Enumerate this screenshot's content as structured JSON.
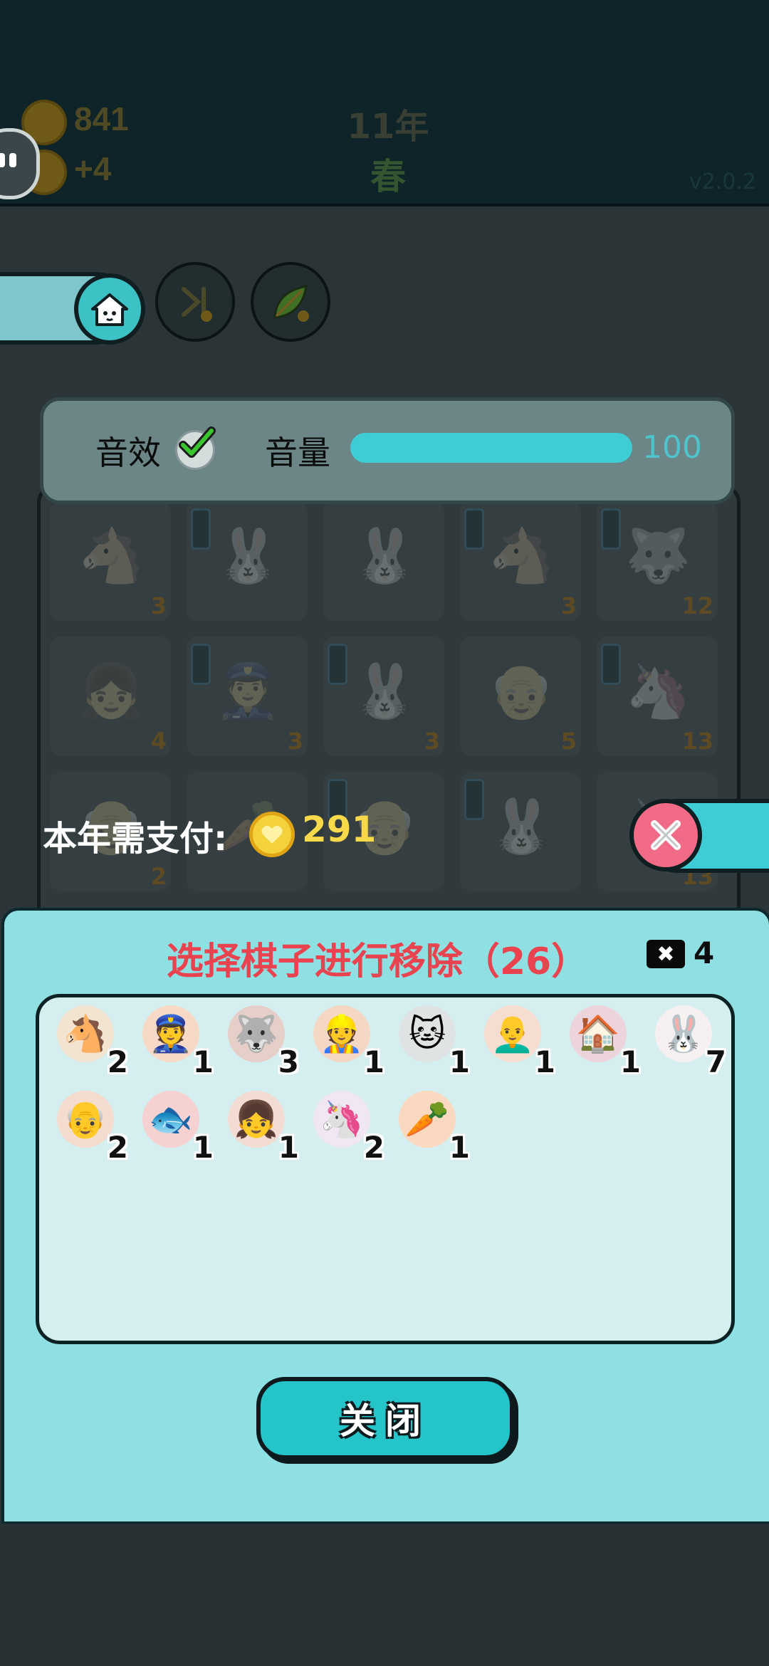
{
  "header": {
    "coins": "841",
    "income": "+4",
    "year": "11年",
    "season": "春",
    "version": "v2.0.2"
  },
  "settings": {
    "sound_label": "音效",
    "sound_enabled": true,
    "volume_label": "音量",
    "volume_value": "100",
    "volume_fraction": 1.0
  },
  "board": {
    "cells": [
      {
        "icon": "horse-icon",
        "glyph": "🐴",
        "count": "3"
      },
      {
        "icon": "rabbit-icon",
        "glyph": "🐰",
        "count": ""
      },
      {
        "icon": "rabbit-icon",
        "glyph": "🐰",
        "count": ""
      },
      {
        "icon": "horse-icon",
        "glyph": "🐴",
        "count": "3"
      },
      {
        "icon": "husky-icon",
        "glyph": "🐺",
        "count": "12"
      },
      {
        "icon": "girl-icon",
        "glyph": "👧",
        "count": "4"
      },
      {
        "icon": "police-icon",
        "glyph": "👮",
        "count": "3"
      },
      {
        "icon": "rabbit-icon",
        "glyph": "🐰",
        "count": "3"
      },
      {
        "icon": "old-man-icon",
        "glyph": "👴",
        "count": "5"
      },
      {
        "icon": "unicorn-icon",
        "glyph": "🦄",
        "count": "13"
      },
      {
        "icon": "grandpa-icon",
        "glyph": "👴",
        "count": "2"
      },
      {
        "icon": "carrot-icon",
        "glyph": "🥕",
        "count": ""
      },
      {
        "icon": "grandpa-icon",
        "glyph": "👴",
        "count": ""
      },
      {
        "icon": "rabbit-icon",
        "glyph": "🐰",
        "count": ""
      },
      {
        "icon": "unicorn-icon",
        "glyph": "🦄",
        "count": "13"
      }
    ]
  },
  "payment": {
    "label": "本年需支付:",
    "amount": "291"
  },
  "modal": {
    "title": "选择棋子进行移除（26）",
    "remove_count": "4",
    "close_label": "关闭",
    "pieces": [
      {
        "name": "horse-icon",
        "glyph": "🐴",
        "bg": "#f3e4d2",
        "count": "2"
      },
      {
        "name": "police-icon",
        "glyph": "👮",
        "bg": "#f6d9c6",
        "count": "1"
      },
      {
        "name": "husky-icon",
        "glyph": "🐺",
        "bg": "#e6cfc9",
        "count": "3"
      },
      {
        "name": "worker-icon",
        "glyph": "👷",
        "bg": "#f4d7c5",
        "count": "1"
      },
      {
        "name": "cat-icon",
        "glyph": "🐱",
        "bg": "#dfe3e4",
        "count": "1"
      },
      {
        "name": "bald-man-icon",
        "glyph": "👨‍🦲",
        "bg": "#f5ddd0",
        "count": "1"
      },
      {
        "name": "house-icon",
        "glyph": "🏠",
        "bg": "#ecd3dc",
        "count": "1"
      },
      {
        "name": "rabbit-icon",
        "glyph": "🐰",
        "bg": "#f6f0f0",
        "count": "7"
      },
      {
        "name": "grandpa-icon",
        "glyph": "👴",
        "bg": "#f4dccf",
        "count": "2"
      },
      {
        "name": "koi-fish-icon",
        "glyph": "🐟",
        "bg": "#f6d1d1",
        "count": "1"
      },
      {
        "name": "girl-icon",
        "glyph": "👧",
        "bg": "#f3dcd4",
        "count": "1"
      },
      {
        "name": "unicorn-icon",
        "glyph": "🦄",
        "bg": "#f1e6f3",
        "count": "2"
      },
      {
        "name": "carrot-icon",
        "glyph": "🥕",
        "bg": "#fbd9c0",
        "count": "1"
      }
    ]
  }
}
